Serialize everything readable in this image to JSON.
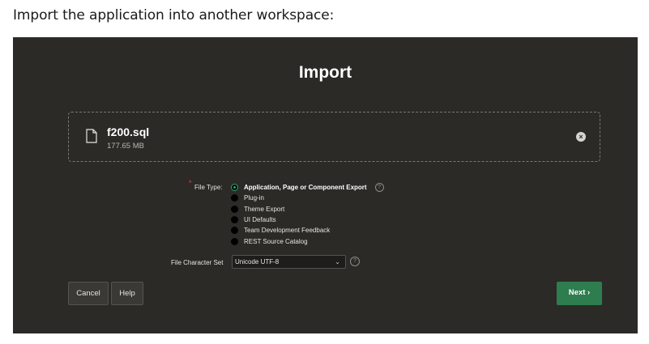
{
  "intro_text": "Import the application into another workspace:",
  "dialog": {
    "title": "Import",
    "file": {
      "name": "f200.sql",
      "size": "177.65 MB",
      "remove_label": "×"
    },
    "file_type": {
      "label": "File Type:",
      "required_marker": "*",
      "help": "?",
      "options": [
        "Application, Page or Component Export",
        "Plug-in",
        "Theme Export",
        "UI Defaults",
        "Team Development Feedback",
        "REST Source Catalog"
      ],
      "selected_index": 0
    },
    "charset": {
      "label": "File Character Set",
      "value": "Unicode UTF-8",
      "help": "?"
    },
    "buttons": {
      "cancel": "Cancel",
      "help": "Help",
      "next": "Next",
      "next_chevron": "›"
    }
  },
  "colors": {
    "panel_background": "#2b2a27",
    "primary_button": "#2e7d4f",
    "selected_radio": "#2ea86a",
    "required_marker": "#e0463b"
  }
}
